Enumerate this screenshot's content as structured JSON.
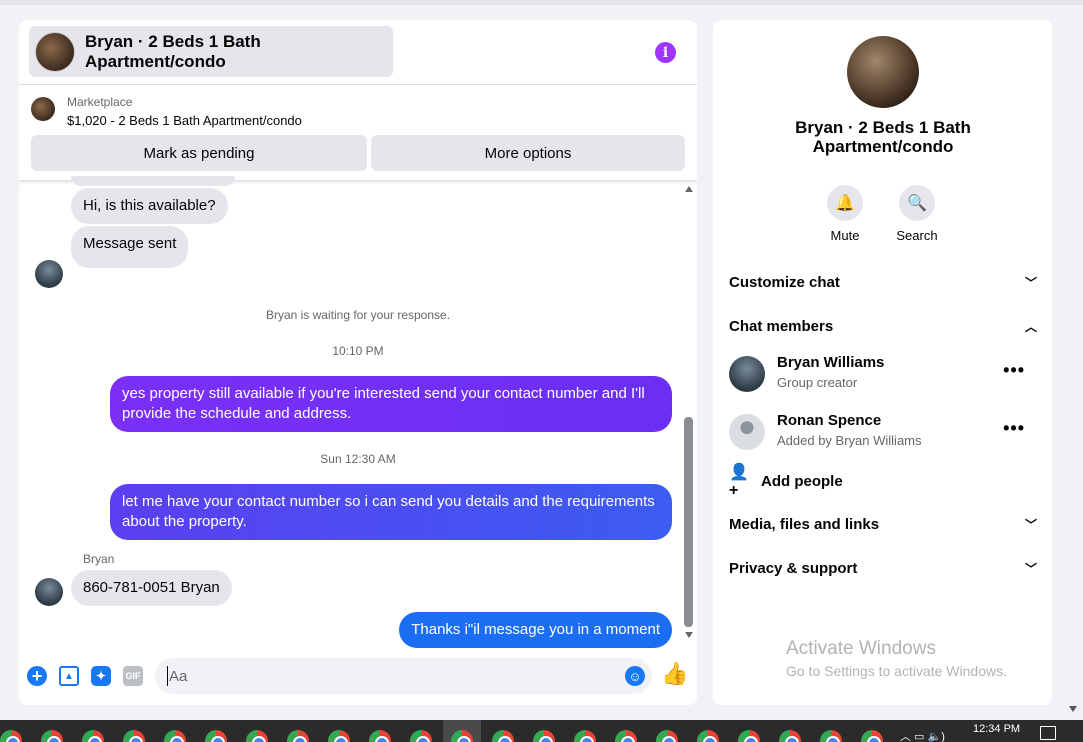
{
  "chat": {
    "title": "Bryan · 2 Beds 1 Bath Apartment/condo",
    "info_icon": "info-icon",
    "marketplace_label": "Marketplace",
    "listing": "$1,020 - 2 Beds 1 Bath Apartment/condo",
    "mark_pending": "Mark as pending",
    "more_options": "More options"
  },
  "messages": {
    "m1": "Hi, is this available?",
    "m2": "Message sent",
    "system": "Bryan is waiting for your response.",
    "ts1": "10:10 PM",
    "m3": "yes property still available if you're interested send your contact number and I'll provide the schedule and address.",
    "ts2": "Sun 12:30 AM",
    "m4": "let me have your contact number so i can send you details and the requirements about the property.",
    "sender": "Bryan",
    "m5": "860-781-0051 Bryan",
    "m6": "Thanks i\"il message you in a moment"
  },
  "composer": {
    "placeholder": "Aa",
    "gif_label": "GIF"
  },
  "sidebar": {
    "title": "Bryan · 2 Beds 1 Bath Apartment/condo",
    "mute": "Mute",
    "search": "Search",
    "customize": "Customize chat",
    "chat_members": "Chat members",
    "members": [
      {
        "name": "Bryan Williams",
        "role": "Group creator"
      },
      {
        "name": "Ronan Spence",
        "role": "Added by Bryan Williams"
      }
    ],
    "add_people": "Add people",
    "media": "Media, files and links",
    "privacy": "Privacy & support"
  },
  "watermark": {
    "title": "Activate Windows",
    "subtitle": "Go to Settings to activate Windows."
  },
  "taskbar": {
    "time": "12:34 PM"
  },
  "colors": {
    "accent": "#1877f2",
    "outgoing_purple": "#7b2ff7",
    "outgoing_blue": "#1b6ef3",
    "info_purple": "#a033ff"
  }
}
